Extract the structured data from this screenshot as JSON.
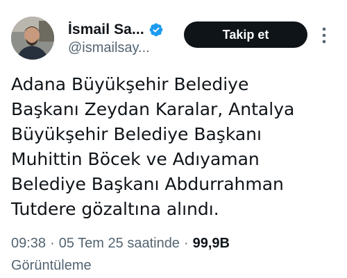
{
  "author": {
    "display_name": "İsmail Sa...",
    "handle": "@ismailsay...",
    "verified": true,
    "avatar_icon": "profile-photo"
  },
  "follow_button": {
    "label": "Takip et"
  },
  "more_icon": "three-dots-vertical-icon",
  "tweet": {
    "lines": [
      "Adana Büyükşehir Belediye",
      "Başkanı Zeydan Karalar, Antalya",
      "Büyükşehir Belediye Başkanı",
      "Muhittin Böcek ve Adıyaman",
      "Belediye Başkanı Abdurrahman",
      "Tutdere gözaltına alındı."
    ]
  },
  "meta": {
    "time": "09:38",
    "separator": "·",
    "date": "05 Tem 25 saatinde",
    "views_count": "99,9B",
    "views_label": "Görüntüleme"
  },
  "colors": {
    "text_primary": "#0f1419",
    "text_secondary": "#536471",
    "button_bg": "#0f1419",
    "verified_blue": "#1d9bf0"
  }
}
